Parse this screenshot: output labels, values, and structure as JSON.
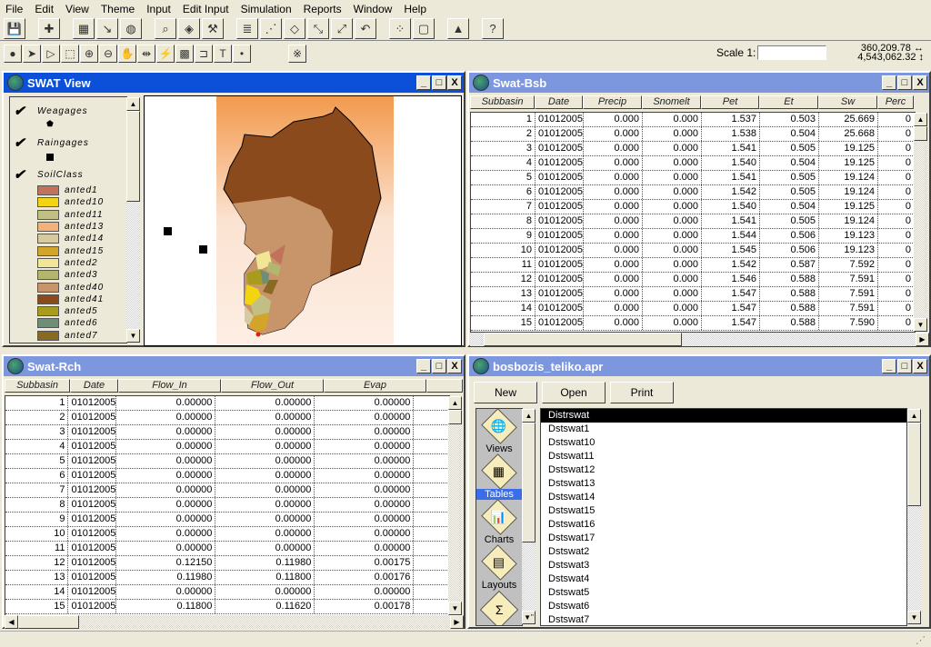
{
  "menu": [
    "File",
    "Edit",
    "View",
    "Theme",
    "Input",
    "Edit Input",
    "Simulation",
    "Reports",
    "Window",
    "Help"
  ],
  "toolbar1": [
    "save-icon",
    "add-theme-icon",
    "theme-properties-icon",
    "edit-legend-icon",
    "hide-legend-icon",
    "find-icon",
    "locate-address-icon",
    "query-builder-icon",
    "zoom-full-extent-icon",
    "zoom-to-themes-icon",
    "zoom-to-selected-icon",
    "zoom-in-icon",
    "zoom-out-icon",
    "zoom-previous-icon",
    "select-by-theme-icon",
    "clear-selection-icon",
    "chart-icon",
    "help-icon"
  ],
  "toolbar2": [
    "identify-icon",
    "pointer-icon",
    "vertex-edit-icon",
    "select-feature-icon",
    "zoom-in-tool-icon",
    "zoom-out-tool-icon",
    "pan-icon",
    "measure-icon",
    "hotlink-icon",
    "area-of-interest-icon",
    "label-icon",
    "text-icon",
    "draw-point-icon",
    "snap-icon"
  ],
  "scale": {
    "label": "Scale 1:",
    "value": ""
  },
  "coords": {
    "x": "360,209.78",
    "y": "4,543,062.32"
  },
  "view": {
    "title": "SWAT View",
    "legend": {
      "weagages": "Weagages",
      "raingages": "Raingages",
      "soilclass": "SoilClass",
      "classes": [
        {
          "label": "anted1",
          "color": "#c0725a"
        },
        {
          "label": "anted10",
          "color": "#f2d410"
        },
        {
          "label": "anted11",
          "color": "#c2bf84"
        },
        {
          "label": "anted13",
          "color": "#f3b27a"
        },
        {
          "label": "anted14",
          "color": "#d6cba0"
        },
        {
          "label": "anted15",
          "color": "#d3a42a"
        },
        {
          "label": "anted2",
          "color": "#f2e596"
        },
        {
          "label": "anted3",
          "color": "#b3b66f"
        },
        {
          "label": "anted40",
          "color": "#c8946a"
        },
        {
          "label": "anted41",
          "color": "#8a4a1c"
        },
        {
          "label": "anted5",
          "color": "#a99b1e"
        },
        {
          "label": "anted6",
          "color": "#6e8e76"
        },
        {
          "label": "anted7",
          "color": "#8a6a22"
        }
      ]
    }
  },
  "bsb": {
    "title": "Swat-Bsb",
    "columns": [
      "Subbasin",
      "Date",
      "Precip",
      "Snomelt",
      "Pet",
      "Et",
      "Sw",
      "Perc"
    ],
    "rows": [
      [
        "1",
        "01012005",
        "0.000",
        "0.000",
        "1.537",
        "0.503",
        "25.669",
        "0"
      ],
      [
        "2",
        "01012005",
        "0.000",
        "0.000",
        "1.538",
        "0.504",
        "25.668",
        "0"
      ],
      [
        "3",
        "01012005",
        "0.000",
        "0.000",
        "1.541",
        "0.505",
        "19.125",
        "0"
      ],
      [
        "4",
        "01012005",
        "0.000",
        "0.000",
        "1.540",
        "0.504",
        "19.125",
        "0"
      ],
      [
        "5",
        "01012005",
        "0.000",
        "0.000",
        "1.541",
        "0.505",
        "19.124",
        "0"
      ],
      [
        "6",
        "01012005",
        "0.000",
        "0.000",
        "1.542",
        "0.505",
        "19.124",
        "0"
      ],
      [
        "7",
        "01012005",
        "0.000",
        "0.000",
        "1.540",
        "0.504",
        "19.125",
        "0"
      ],
      [
        "8",
        "01012005",
        "0.000",
        "0.000",
        "1.541",
        "0.505",
        "19.124",
        "0"
      ],
      [
        "9",
        "01012005",
        "0.000",
        "0.000",
        "1.544",
        "0.506",
        "19.123",
        "0"
      ],
      [
        "10",
        "01012005",
        "0.000",
        "0.000",
        "1.545",
        "0.506",
        "19.123",
        "0"
      ],
      [
        "11",
        "01012005",
        "0.000",
        "0.000",
        "1.542",
        "0.587",
        "7.592",
        "0"
      ],
      [
        "12",
        "01012005",
        "0.000",
        "0.000",
        "1.546",
        "0.588",
        "7.591",
        "0"
      ],
      [
        "13",
        "01012005",
        "0.000",
        "0.000",
        "1.547",
        "0.588",
        "7.591",
        "0"
      ],
      [
        "14",
        "01012005",
        "0.000",
        "0.000",
        "1.547",
        "0.588",
        "7.591",
        "0"
      ],
      [
        "15",
        "01012005",
        "0.000",
        "0.000",
        "1.547",
        "0.588",
        "7.590",
        "0"
      ]
    ]
  },
  "rch": {
    "title": "Swat-Rch",
    "columns": [
      "Subbasin",
      "Date",
      "Flow_In",
      "Flow_Out",
      "Evap",
      ""
    ],
    "rows": [
      [
        "1",
        "01012005",
        "0.00000",
        "0.00000",
        "0.00000",
        ""
      ],
      [
        "2",
        "01012005",
        "0.00000",
        "0.00000",
        "0.00000",
        ""
      ],
      [
        "3",
        "01012005",
        "0.00000",
        "0.00000",
        "0.00000",
        ""
      ],
      [
        "4",
        "01012005",
        "0.00000",
        "0.00000",
        "0.00000",
        ""
      ],
      [
        "5",
        "01012005",
        "0.00000",
        "0.00000",
        "0.00000",
        ""
      ],
      [
        "6",
        "01012005",
        "0.00000",
        "0.00000",
        "0.00000",
        ""
      ],
      [
        "7",
        "01012005",
        "0.00000",
        "0.00000",
        "0.00000",
        ""
      ],
      [
        "8",
        "01012005",
        "0.00000",
        "0.00000",
        "0.00000",
        ""
      ],
      [
        "9",
        "01012005",
        "0.00000",
        "0.00000",
        "0.00000",
        ""
      ],
      [
        "10",
        "01012005",
        "0.00000",
        "0.00000",
        "0.00000",
        ""
      ],
      [
        "11",
        "01012005",
        "0.00000",
        "0.00000",
        "0.00000",
        ""
      ],
      [
        "12",
        "01012005",
        "0.12150",
        "0.11980",
        "0.00175",
        ""
      ],
      [
        "13",
        "01012005",
        "0.11980",
        "0.11800",
        "0.00176",
        ""
      ],
      [
        "14",
        "01012005",
        "0.00000",
        "0.00000",
        "0.00000",
        ""
      ],
      [
        "15",
        "01012005",
        "0.11800",
        "0.11620",
        "0.00178",
        ""
      ]
    ]
  },
  "project": {
    "title": "bosbozis_teliko.apr",
    "buttons": {
      "new": "New",
      "open": "Open",
      "print": "Print"
    },
    "doc_types": [
      {
        "label": "Views",
        "icon": "globe-icon"
      },
      {
        "label": "Tables",
        "icon": "table-icon",
        "selected": true
      },
      {
        "label": "Charts",
        "icon": "chart-icon"
      },
      {
        "label": "Layouts",
        "icon": "layout-icon"
      },
      {
        "label": "",
        "icon": "script-icon"
      }
    ],
    "items": [
      "Distrswat",
      "Dstswat1",
      "Dstswat10",
      "Dstswat11",
      "Dstswat12",
      "Dstswat13",
      "Dstswat14",
      "Dstswat15",
      "Dstswat16",
      "Dstswat17",
      "Dstswat2",
      "Dstswat3",
      "Dstswat4",
      "Dstswat5",
      "Dstswat6",
      "Dstswat7"
    ],
    "selected": "Distrswat"
  }
}
